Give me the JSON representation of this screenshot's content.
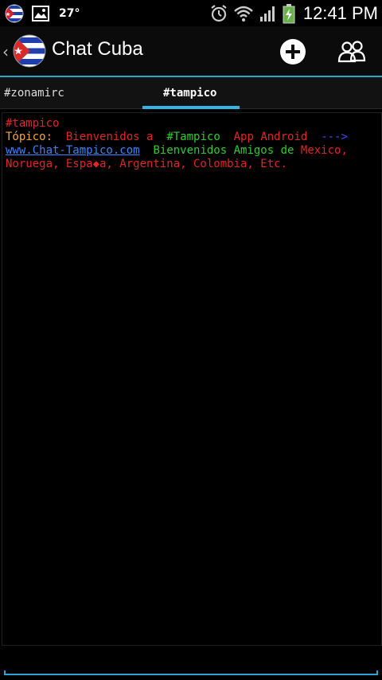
{
  "status_bar": {
    "temperature": "27°",
    "time": "12:41 PM"
  },
  "action_bar": {
    "title": "Chat Cuba",
    "back_glyph": "‹",
    "icons": [
      "cuba-flag-icon",
      "add-icon",
      "users-icon"
    ]
  },
  "tabs": [
    {
      "label": "#zonamirc",
      "active": false
    },
    {
      "label": "#tampico",
      "active": true
    }
  ],
  "chat": {
    "channel_line": "#tampico",
    "topic_label": "Tópico:",
    "topic_welcome": "Bienvenidos a",
    "topic_channel": "#Tampico",
    "topic_app": "App Android",
    "topic_arrow": "--->",
    "topic_link": "www.Chat-Tampico.com",
    "topic_welcome2": "Bienvenidos Amigos de",
    "topic_countries_1": "Mexico,",
    "topic_countries_2": "Noruega, Espa◆a, Argentina, Colombia, Etc."
  },
  "input": {
    "value": "",
    "placeholder": ""
  },
  "colors": {
    "accent": "#33b5e5",
    "red": "#e02626",
    "green": "#2ecc2e",
    "orange": "#f2a53a",
    "blue": "#3a4cff",
    "link": "#3a85ff"
  }
}
